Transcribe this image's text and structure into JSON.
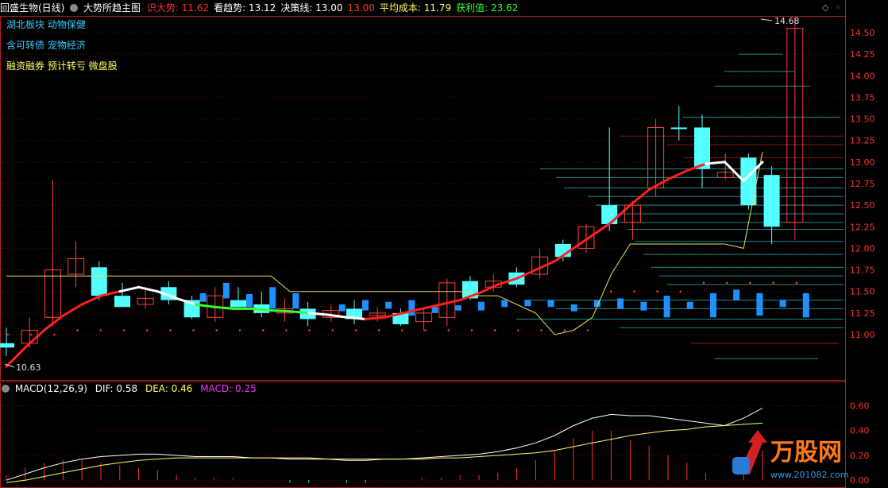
{
  "header": {
    "stock_title": "回盛生物(日线)",
    "indicator_name": "大势所趋主图",
    "items": [
      {
        "label": "识大势: ",
        "value": "11.62",
        "label_color": "#ff3030",
        "value_color": "#ff3030"
      },
      {
        "label": "看趋势: ",
        "value": "13.12",
        "label_color": "#ffffff",
        "value_color": "#ffffff"
      },
      {
        "label": "决策线: ",
        "value": "13.00",
        "label_color": "#ffffff",
        "value_color": "#ffffff"
      },
      {
        "label": "",
        "value": "13.00",
        "label_color": "#ff3030",
        "value_color": "#ff3030"
      },
      {
        "label": "平均成本: ",
        "value": "11.79",
        "label_color": "#ffff66",
        "value_color": "#ffff66"
      },
      {
        "label": "获利值: ",
        "value": "23.62",
        "label_color": "#33ff33",
        "value_color": "#33ff33"
      }
    ],
    "colors": {
      "title": "#ffffff",
      "accent_red": "#ff3030"
    }
  },
  "tags": {
    "line1": "湖北板块 动物保健",
    "line2": "含可转债 宠物经济",
    "line3": "融资融券 预计转亏 微盘股",
    "line1_color": "#33ccff",
    "line2_color": "#33ccff",
    "line3_color": "#ffff66"
  },
  "price_axis": {
    "labels": [
      "14.50",
      "14.25",
      "14.00",
      "13.75",
      "13.50",
      "13.25",
      "13.00",
      "12.75",
      "12.50",
      "12.25",
      "12.00",
      "11.75",
      "11.50",
      "11.25",
      "11.00"
    ],
    "high_label": "14.68",
    "low_label": "10.63"
  },
  "macd": {
    "title": "MACD(12,26,9)",
    "dif_label": "DIF: ",
    "dif_value": "0.58",
    "dea_label": "DEA: ",
    "dea_value": "0.46",
    "macd_label": "MACD: ",
    "macd_value": "0.25",
    "axis_labels": [
      "0.60",
      "0.40",
      "0.20",
      "0.00"
    ],
    "colors": {
      "dif": "#ffffff",
      "dea": "#ffff66",
      "macd": "#ff33ff"
    }
  },
  "watermark": {
    "brand": "万股网",
    "url": "www.201082.com"
  },
  "chart_data": {
    "type": "candlestick",
    "ylim": [
      10.63,
      14.68
    ],
    "candles": [
      {
        "o": 10.85,
        "h": 11.08,
        "l": 10.75,
        "c": 10.9,
        "up": false
      },
      {
        "o": 10.9,
        "h": 11.2,
        "l": 10.85,
        "c": 11.05,
        "up": true
      },
      {
        "o": 11.2,
        "h": 12.8,
        "l": 11.1,
        "c": 11.75,
        "up": true
      },
      {
        "o": 11.7,
        "h": 12.08,
        "l": 11.55,
        "c": 11.88,
        "up": true
      },
      {
        "o": 11.78,
        "h": 11.85,
        "l": 11.4,
        "c": 11.45,
        "up": false
      },
      {
        "o": 11.45,
        "h": 11.6,
        "l": 11.35,
        "c": 11.32,
        "up": false
      },
      {
        "o": 11.35,
        "h": 11.55,
        "l": 11.3,
        "c": 11.42,
        "up": true
      },
      {
        "o": 11.55,
        "h": 11.62,
        "l": 11.35,
        "c": 11.4,
        "up": false
      },
      {
        "o": 11.4,
        "h": 11.45,
        "l": 11.18,
        "c": 11.2,
        "up": false
      },
      {
        "o": 11.2,
        "h": 11.55,
        "l": 11.15,
        "c": 11.45,
        "up": true
      },
      {
        "o": 11.4,
        "h": 11.55,
        "l": 11.3,
        "c": 11.32,
        "up": false
      },
      {
        "o": 11.35,
        "h": 11.5,
        "l": 11.2,
        "c": 11.25,
        "up": false
      },
      {
        "o": 11.25,
        "h": 11.42,
        "l": 11.15,
        "c": 11.3,
        "up": true
      },
      {
        "o": 11.3,
        "h": 11.38,
        "l": 11.1,
        "c": 11.18,
        "up": false
      },
      {
        "o": 11.2,
        "h": 11.35,
        "l": 11.15,
        "c": 11.28,
        "up": true
      },
      {
        "o": 11.3,
        "h": 11.4,
        "l": 11.12,
        "c": 11.18,
        "up": false
      },
      {
        "o": 11.22,
        "h": 11.32,
        "l": 11.15,
        "c": 11.25,
        "up": true
      },
      {
        "o": 11.25,
        "h": 11.3,
        "l": 11.1,
        "c": 11.12,
        "up": false
      },
      {
        "o": 11.15,
        "h": 11.3,
        "l": 11.05,
        "c": 11.25,
        "up": true
      },
      {
        "o": 11.2,
        "h": 11.65,
        "l": 11.1,
        "c": 11.6,
        "up": true
      },
      {
        "o": 11.62,
        "h": 11.68,
        "l": 11.4,
        "c": 11.42,
        "up": false
      },
      {
        "o": 11.55,
        "h": 11.7,
        "l": 11.5,
        "c": 11.62,
        "up": true
      },
      {
        "o": 11.58,
        "h": 11.78,
        "l": 11.55,
        "c": 11.72,
        "up": false
      },
      {
        "o": 11.7,
        "h": 12.0,
        "l": 11.65,
        "c": 11.9,
        "up": true
      },
      {
        "o": 11.9,
        "h": 12.1,
        "l": 11.85,
        "c": 12.05,
        "up": false
      },
      {
        "o": 12.0,
        "h": 12.28,
        "l": 11.95,
        "c": 12.25,
        "up": true
      },
      {
        "o": 12.28,
        "h": 13.4,
        "l": 12.2,
        "c": 12.5,
        "up": false
      },
      {
        "o": 12.3,
        "h": 12.55,
        "l": 12.1,
        "c": 12.5,
        "up": true
      },
      {
        "o": 12.7,
        "h": 13.5,
        "l": 12.6,
        "c": 13.4,
        "up": true
      },
      {
        "o": 13.4,
        "h": 13.65,
        "l": 13.25,
        "c": 13.4,
        "up": false
      },
      {
        "o": 13.4,
        "h": 13.55,
        "l": 12.7,
        "c": 12.92,
        "up": false
      },
      {
        "o": 12.88,
        "h": 13.1,
        "l": 12.8,
        "c": 12.82,
        "up": true
      },
      {
        "o": 13.05,
        "h": 13.1,
        "l": 12.45,
        "c": 12.5,
        "up": false
      },
      {
        "o": 12.85,
        "h": 12.95,
        "l": 12.05,
        "c": 12.25,
        "up": false
      },
      {
        "o": 12.3,
        "h": 14.68,
        "l": 12.1,
        "c": 14.55,
        "up": true
      }
    ],
    "trend_line": [
      10.63,
      10.85,
      11.05,
      11.22,
      11.35,
      11.45,
      11.5,
      11.55,
      11.5,
      11.42,
      11.35,
      11.32,
      11.3,
      11.3,
      11.28,
      11.27,
      11.25,
      11.23,
      11.2,
      11.18,
      11.2,
      11.25,
      11.3,
      11.35,
      11.4,
      11.48,
      11.58,
      11.65,
      11.75,
      11.85,
      12.0,
      12.15,
      12.3,
      12.5,
      12.68,
      12.8,
      12.9,
      12.98,
      13.0,
      12.78,
      13.0
    ],
    "avg_cost_line": [
      11.68,
      11.68,
      11.68,
      11.68,
      11.68,
      11.68,
      11.68,
      11.68,
      11.68,
      11.68,
      11.68,
      11.68,
      11.68,
      11.68,
      11.68,
      11.5,
      11.5,
      11.5,
      11.5,
      11.5,
      11.5,
      11.5,
      11.5,
      11.5,
      11.5,
      11.45,
      11.45,
      11.35,
      11.25,
      11.0,
      11.05,
      11.2,
      11.7,
      12.05,
      12.05,
      12.05,
      12.05,
      12.05,
      12.05,
      12.0,
      13.12
    ],
    "macd_ylim": [
      -0.05,
      0.68
    ],
    "dif": [
      0.0,
      0.05,
      0.1,
      0.14,
      0.17,
      0.19,
      0.2,
      0.21,
      0.21,
      0.2,
      0.19,
      0.19,
      0.19,
      0.18,
      0.18,
      0.17,
      0.17,
      0.17,
      0.16,
      0.16,
      0.17,
      0.17,
      0.18,
      0.19,
      0.2,
      0.21,
      0.23,
      0.26,
      0.3,
      0.36,
      0.44,
      0.5,
      0.53,
      0.52,
      0.52,
      0.5,
      0.48,
      0.46,
      0.44,
      0.5,
      0.58
    ],
    "dea": [
      -0.02,
      0.0,
      0.03,
      0.06,
      0.09,
      0.12,
      0.14,
      0.16,
      0.17,
      0.18,
      0.18,
      0.18,
      0.18,
      0.18,
      0.18,
      0.18,
      0.18,
      0.17,
      0.17,
      0.17,
      0.17,
      0.17,
      0.17,
      0.18,
      0.18,
      0.19,
      0.2,
      0.21,
      0.22,
      0.24,
      0.27,
      0.3,
      0.33,
      0.36,
      0.38,
      0.4,
      0.41,
      0.43,
      0.44,
      0.45,
      0.46
    ]
  }
}
